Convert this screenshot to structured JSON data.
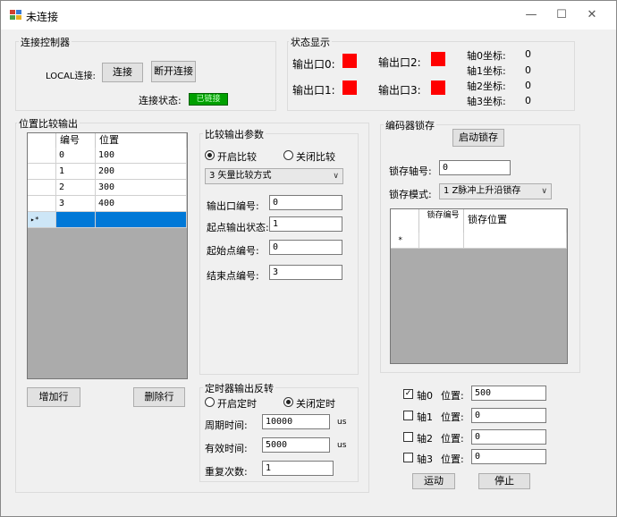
{
  "window": {
    "title": "未连接",
    "minimize": "—",
    "maximize": "☐",
    "close": "✕"
  },
  "connect": {
    "group_label": "连接控制器",
    "local_label": "LOCAL连接:",
    "connect_btn": "连接",
    "disconnect_btn": "断开连接",
    "state_label": "连接状态:",
    "state_value": "已链接"
  },
  "status": {
    "group_label": "状态显示",
    "out0": "输出口0:",
    "out1": "输出口1:",
    "out2": "输出口2:",
    "out3": "输出口3:",
    "axis0": "轴0坐标:",
    "axis1": "轴1坐标:",
    "axis2": "轴2坐标:",
    "axis3": "轴3坐标:",
    "axis0_val": "0",
    "axis1_val": "0",
    "axis2_val": "0",
    "axis3_val": "0",
    "out_color": "#ff0000"
  },
  "compare": {
    "group_label": "位置比较输出",
    "headers": [
      "编号",
      "位置"
    ],
    "rows": [
      [
        "0",
        "100"
      ],
      [
        "1",
        "200"
      ],
      [
        "2",
        "300"
      ],
      [
        "3",
        "400"
      ]
    ],
    "new_row_marker": "▸*",
    "add_btn": "增加行",
    "del_btn": "删除行"
  },
  "params": {
    "group_label": "比较输出参数",
    "enable": "开启比较",
    "disable": "关闭比较",
    "mode": "3 矢量比较方式",
    "out_no_label": "输出口编号:",
    "out_no": "0",
    "start_state_label": "起点输出状态:",
    "start_state": "1",
    "start_pt_label": "起始点编号:",
    "start_pt": "0",
    "end_pt_label": "结束点编号:",
    "end_pt": "3"
  },
  "timer": {
    "group_label": "定时器输出反转",
    "enable": "开启定时",
    "disable": "关闭定时",
    "period_label": "周期时间:",
    "period": "10000",
    "period_unit": "us",
    "valid_label": "有效时间:",
    "valid": "5000",
    "valid_unit": "us",
    "repeat_label": "重复次数:",
    "repeat": "1"
  },
  "latch": {
    "group_label": "编码器锁存",
    "start_btn": "启动锁存",
    "axis_label": "锁存轴号:",
    "axis": "0",
    "mode_label": "锁存模式:",
    "mode": "1 Z脉冲上升沿锁存",
    "headers": [
      "锁存编号",
      "锁存位置"
    ],
    "new_row_marker": "*"
  },
  "motion": {
    "axes": [
      {
        "label": "轴0",
        "pos_label": "位置:",
        "value": "500",
        "checked": true
      },
      {
        "label": "轴1",
        "pos_label": "位置:",
        "value": "0",
        "checked": false
      },
      {
        "label": "轴2",
        "pos_label": "位置:",
        "value": "0",
        "checked": false
      },
      {
        "label": "轴3",
        "pos_label": "位置:",
        "value": "0",
        "checked": false
      }
    ],
    "move_btn": "运动",
    "stop_btn": "停止"
  }
}
